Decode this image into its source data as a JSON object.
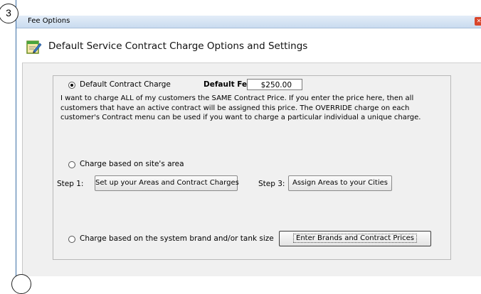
{
  "markers": {
    "top": "3",
    "bottom": ""
  },
  "window": {
    "title": "Fee Options",
    "close_glyph": "✕",
    "header_title": "Default Service Contract Charge Options and Settings",
    "header_icon": "edit-form-icon"
  },
  "default_charge": {
    "radio_label": "Default Contract Charge",
    "selected": true,
    "fee_label": "Default Fee:",
    "fee_value": "$250.00",
    "description_lines": [
      "I want to charge ALL of my customers the SAME Contract Price.  If you enter the price here, then all",
      "customers that have an active contract will be assigned this price.  The OVERRIDE charge on each",
      "customer's Contract menu can be used if you want to charge a particular individual a unique charge."
    ]
  },
  "area_charge": {
    "radio_label": "Charge based on site's area",
    "selected": false,
    "step1_label": "Step 1:",
    "step1_button": "Set up your Areas and Contract Charges",
    "step3_label": "Step 3:",
    "step3_button": "Assign Areas to your Cities"
  },
  "brand_charge": {
    "radio_label": "Charge based on the system brand and/or tank size",
    "selected": false,
    "button": "Enter Brands and Contract Prices"
  },
  "colors": {
    "titlebar": "#c9dbef",
    "content_bg": "#f0f0f0",
    "close": "#d9462b"
  }
}
